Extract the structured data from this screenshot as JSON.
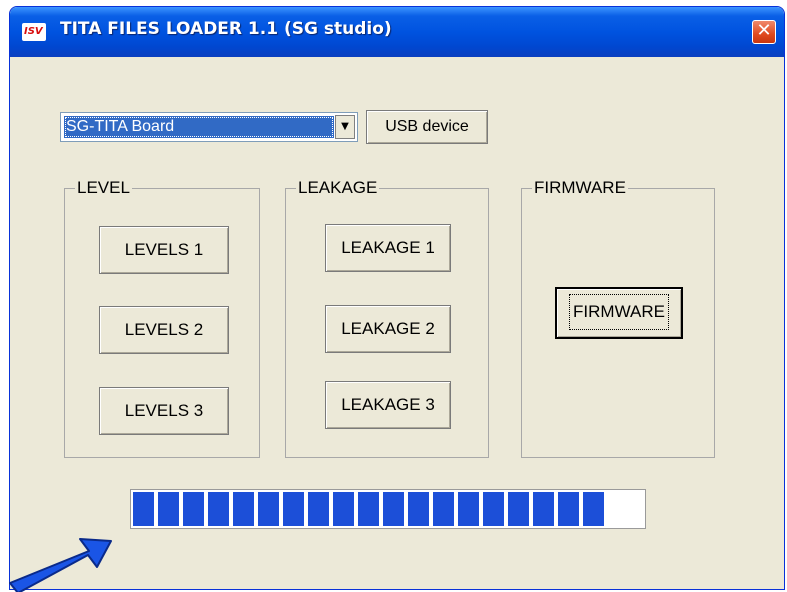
{
  "window": {
    "title": "TITA FILES LOADER 1.1 (SG studio)",
    "close_glyph": "✕",
    "app_icon": "app-logo-icon"
  },
  "device": {
    "selected": "SG-TITA Board",
    "dropdown_glyph": "▼",
    "usb_button": "USB device"
  },
  "groups": {
    "level": {
      "label": "LEVEL",
      "buttons": [
        "LEVELS 1",
        "LEVELS 2",
        "LEVELS 3"
      ]
    },
    "leakage": {
      "label": "LEAKAGE",
      "buttons": [
        "LEAKAGE 1",
        "LEAKAGE 2",
        "LEAKAGE 3"
      ]
    },
    "firmware": {
      "label": "FIRMWARE",
      "button": "FIRMWARE"
    }
  },
  "progress": {
    "fraction": 0.97,
    "color": "#1c4fd8"
  },
  "pointer": {
    "icon": "blue-arrow-icon",
    "color": "#1a55e6"
  }
}
